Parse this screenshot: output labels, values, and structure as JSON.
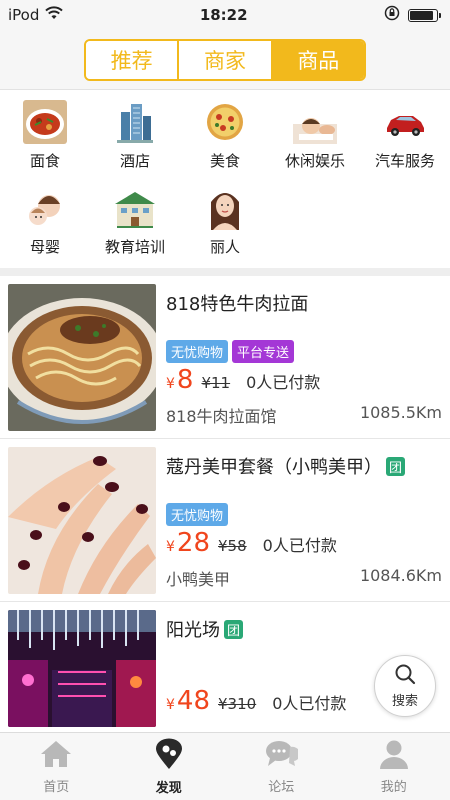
{
  "status": {
    "carrier": "iPod",
    "time": "18:22",
    "battery_level": 0.9
  },
  "header": {
    "segments": [
      {
        "label": "推荐",
        "active": false
      },
      {
        "label": "商家",
        "active": false
      },
      {
        "label": "商品",
        "active": true
      }
    ]
  },
  "categories": [
    {
      "label": "面食",
      "icon": "noodle-dish-icon"
    },
    {
      "label": "酒店",
      "icon": "hotel-building-icon"
    },
    {
      "label": "美食",
      "icon": "pizza-icon"
    },
    {
      "label": "休闲娱乐",
      "icon": "spa-massage-icon"
    },
    {
      "label": "汽车服务",
      "icon": "car-icon"
    },
    {
      "label": "母婴",
      "icon": "mother-baby-icon"
    },
    {
      "label": "教育培训",
      "icon": "school-building-icon"
    },
    {
      "label": "丽人",
      "icon": "beauty-woman-icon"
    }
  ],
  "items": [
    {
      "title": "818特色牛肉拉面",
      "group_badge": "",
      "tags": [
        "无忧购物",
        "平台专送"
      ],
      "currency": "¥",
      "price": "8",
      "original_price": "¥11",
      "paid": "0人已付款",
      "shop": "818牛肉拉面馆",
      "distance": "1085.5Km"
    },
    {
      "title": "蔻丹美甲套餐（小鸭美甲）",
      "group_badge": "团",
      "tags": [
        "无忧购物"
      ],
      "currency": "¥",
      "price": "28",
      "original_price": "¥58",
      "paid": "0人已付款",
      "shop": "小鸭美甲",
      "distance": "1084.6Km"
    },
    {
      "title": "阳光场",
      "group_badge": "团",
      "tags": [],
      "currency": "¥",
      "price": "48",
      "original_price": "¥310",
      "paid": "0人已付款",
      "shop": "",
      "distance": ""
    }
  ],
  "fab": {
    "label": "搜索"
  },
  "tabbar": [
    {
      "label": "首页",
      "icon": "home-icon",
      "active": false
    },
    {
      "label": "发现",
      "icon": "location-pin-icon",
      "active": true
    },
    {
      "label": "论坛",
      "icon": "chat-bubbles-icon",
      "active": false
    },
    {
      "label": "我的",
      "icon": "user-icon",
      "active": false
    }
  ],
  "colors": {
    "accent": "#f2b91c",
    "price": "#f0451d",
    "tag_blue": "#5ea9e8",
    "tag_purple": "#a437d6",
    "group_green": "#2aa876"
  }
}
